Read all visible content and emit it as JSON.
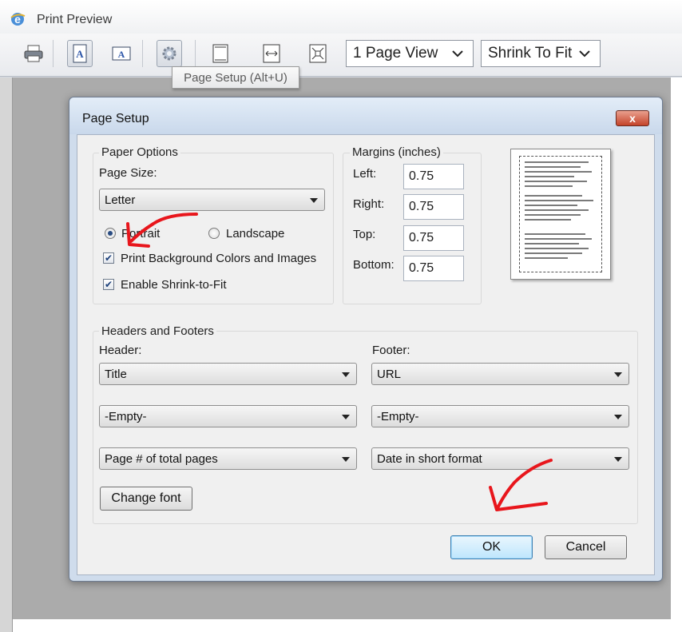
{
  "window": {
    "title": "Print Preview"
  },
  "toolbar": {
    "page_view_value": "1 Page View",
    "shrink_value": "Shrink To Fit",
    "tooltip": "Page Setup (Alt+U)"
  },
  "dialog": {
    "title": "Page Setup",
    "close_label": "x",
    "paper_options": {
      "legend": "Paper Options",
      "page_size_label": "Page Size:",
      "page_size_value": "Letter",
      "portrait_label": "Portrait",
      "landscape_label": "Landscape",
      "print_bg_label": "Print Background Colors and Images",
      "shrink_label": "Enable Shrink-to-Fit",
      "portrait_selected": true,
      "print_bg_checked": true,
      "shrink_checked": true
    },
    "margins": {
      "legend": "Margins (inches)",
      "left_label": "Left:",
      "left_value": "0.75",
      "right_label": "Right:",
      "right_value": "0.75",
      "top_label": "Top:",
      "top_value": "0.75",
      "bottom_label": "Bottom:",
      "bottom_value": "0.75"
    },
    "headers_footers": {
      "legend": "Headers and Footers",
      "header_label": "Header:",
      "footer_label": "Footer:",
      "header_1": "Title",
      "header_2": "-Empty-",
      "header_3": "Page # of total pages",
      "footer_1": "URL",
      "footer_2": "-Empty-",
      "footer_3": "Date in short format",
      "change_font_label": "Change font"
    },
    "ok_label": "OK",
    "cancel_label": "Cancel"
  },
  "colors": {
    "annotation_arrow": "#e8161c",
    "dialog_frame": "#cfdcec",
    "default_button": "#bee6fd"
  }
}
